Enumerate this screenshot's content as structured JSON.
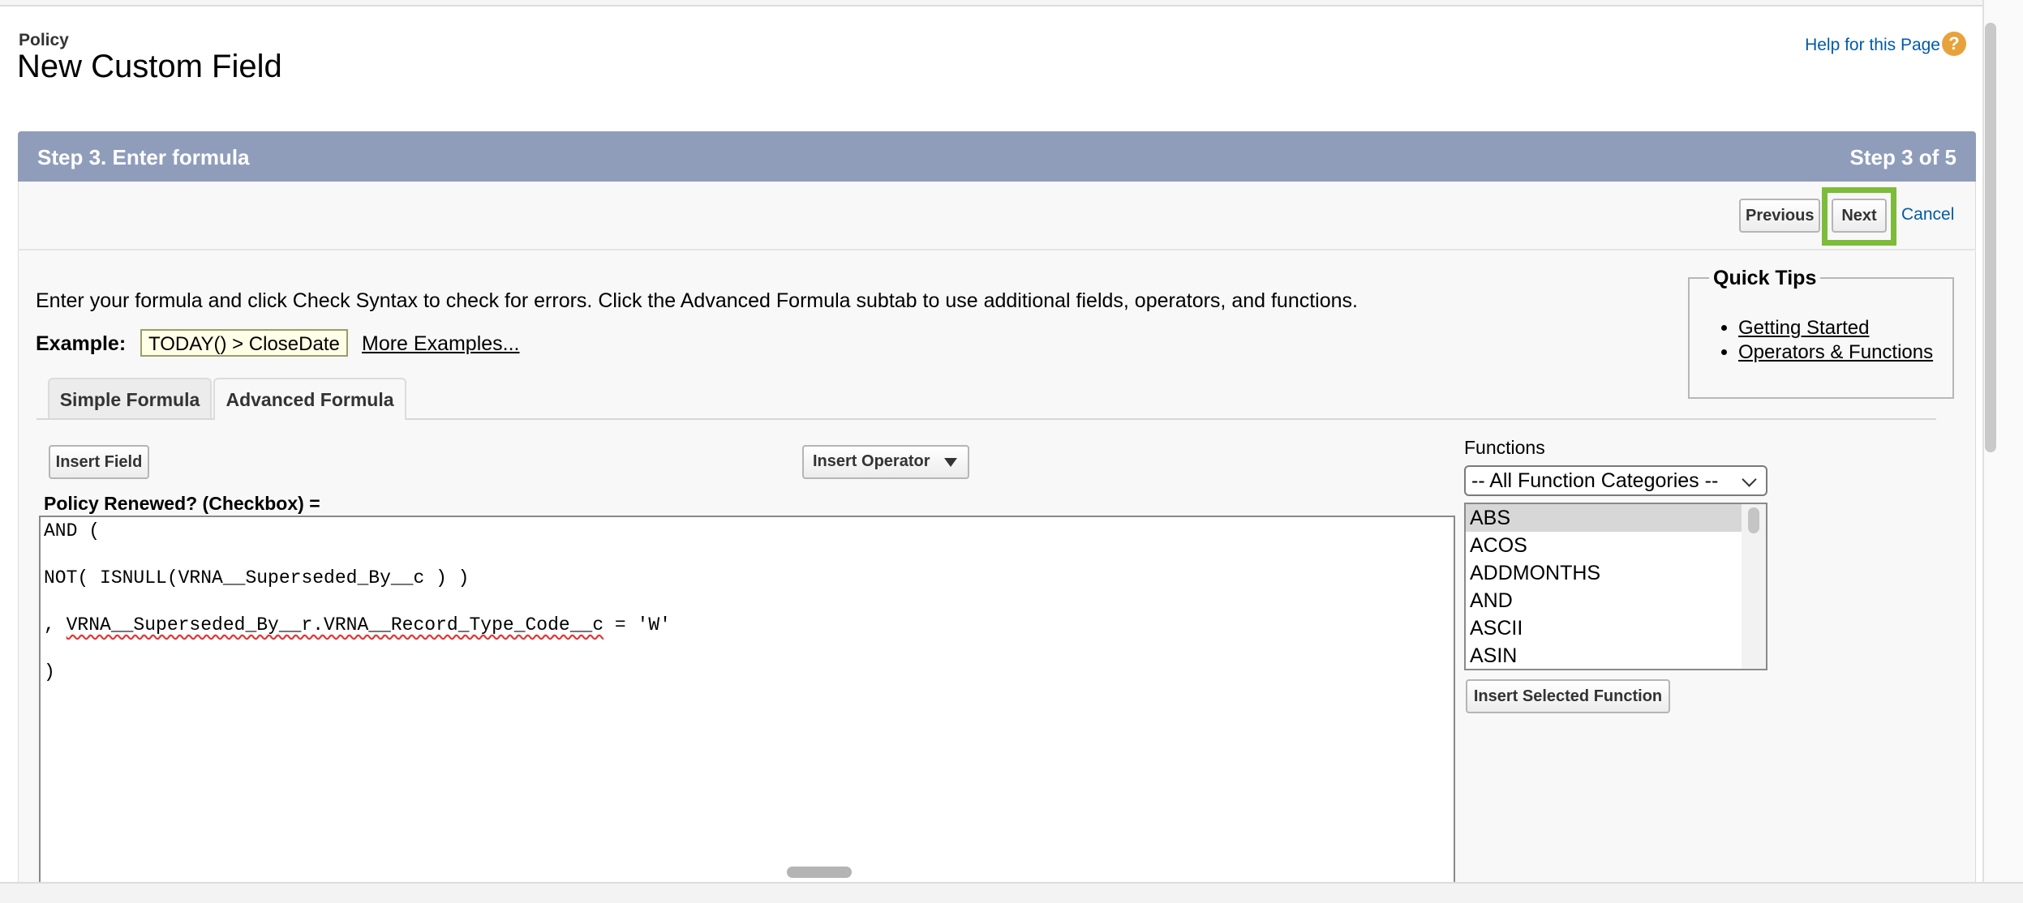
{
  "header": {
    "object_type": "Policy",
    "page_title": "New Custom Field",
    "help_link": "Help for this Page",
    "help_icon": "?"
  },
  "step": {
    "title": "Step 3. Enter formula",
    "count": "Step 3 of 5"
  },
  "nav_buttons": {
    "previous": "Previous",
    "next": "Next",
    "cancel": "Cancel",
    "highlight_color": "#7cbc3a"
  },
  "instructions": "Enter your formula and click Check Syntax to check for errors. Click the Advanced Formula subtab to use additional fields, operators, and functions.",
  "example": {
    "label": "Example:",
    "code": "TODAY() > CloseDate",
    "more_link": "More Examples..."
  },
  "quick_tips": {
    "title": "Quick Tips",
    "links": [
      "Getting Started",
      "Operators & Functions"
    ]
  },
  "tabs": [
    {
      "label": "Simple Formula",
      "active": false
    },
    {
      "label": "Advanced Formula",
      "active": true
    }
  ],
  "editor": {
    "insert_field": "Insert Field",
    "insert_operator": "Insert Operator",
    "formula_label": "Policy Renewed? (Checkbox) =",
    "lines": [
      "AND (",
      "NOT( ISNULL(VRNA__Superseded_By__c ) )",
      ", ",
      "VRNA__Superseded_By__r.VRNA__Record_Type_Code__c",
      " = 'W'",
      ")"
    ]
  },
  "functions": {
    "label": "Functions",
    "category_selected": "-- All Function Categories --",
    "items": [
      "ABS",
      "ACOS",
      "ADDMONTHS",
      "AND",
      "ASCII",
      "ASIN"
    ],
    "selected": "ABS",
    "insert_button": "Insert Selected Function"
  },
  "colors": {
    "step_bar": "#8f9dbb",
    "link": "#015ba7",
    "help_icon": "#e8a23c"
  }
}
